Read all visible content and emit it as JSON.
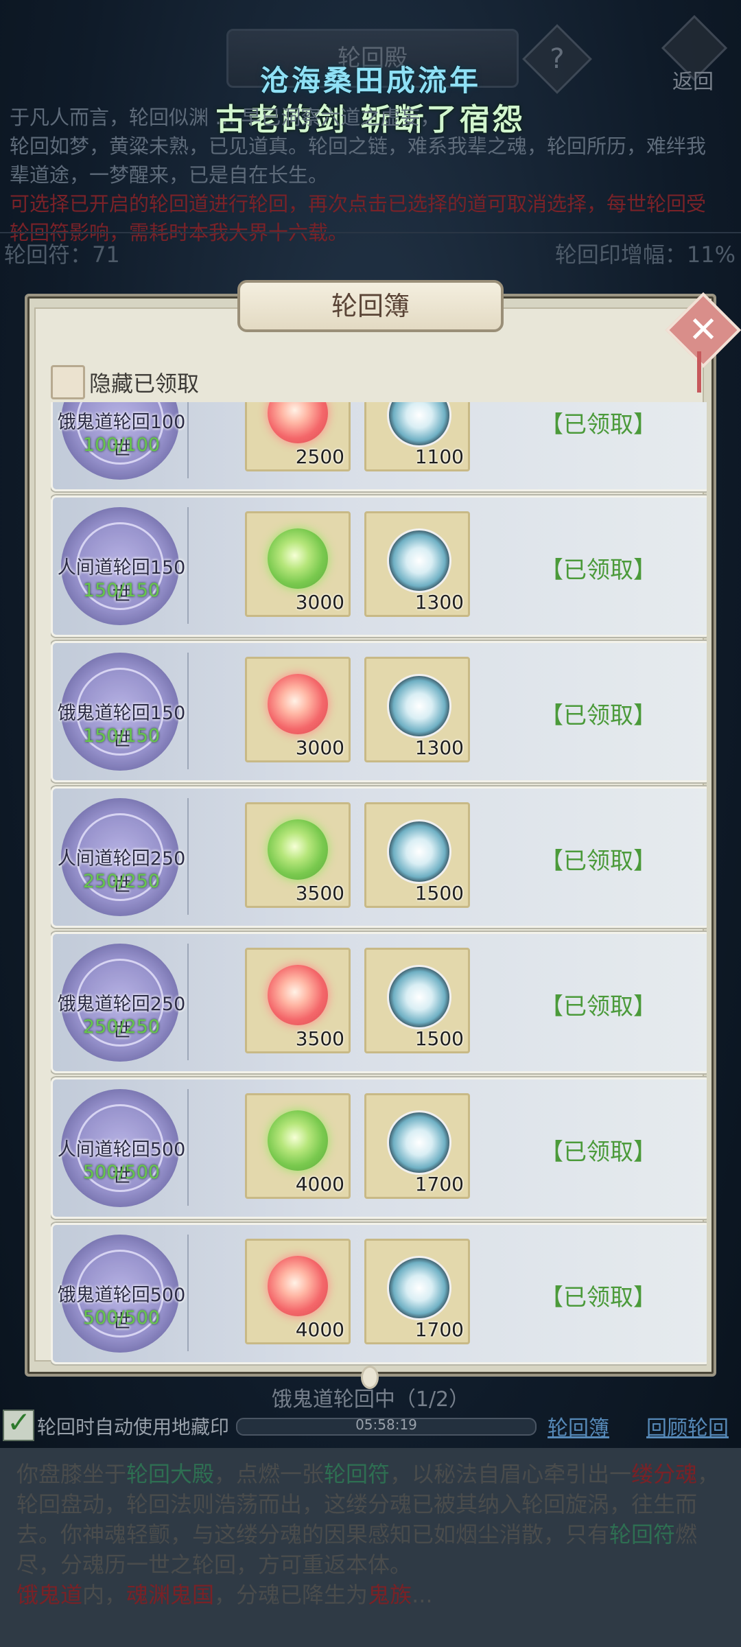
{
  "header": {
    "title": "轮回殿",
    "help_label": "?",
    "back_label": "返回",
    "banner_line1": "沧海桑田成流年",
    "banner_line2": "古老的剑 斩断了宿怨"
  },
  "intro": {
    "line1": "于凡人而言，轮回似渊 … 早已洞察六道之虚妄，",
    "line2": "轮回如梦，黄粱未熟，已见道真。轮回之链，难系我辈之魂，轮回所历，难绊我",
    "line3": "辈道途，一梦醒来，已是自在长生。",
    "warn1": "可选择已开启的轮回道进行轮回，再次点击已选择的道可取消选择，每世轮回受",
    "warn2": "轮回符影响，需耗时本我大界十六载。"
  },
  "stats": {
    "left": "轮回符：71",
    "right": "轮回印增幅：11%"
  },
  "modal": {
    "title": "轮回簿",
    "close_label": "✕",
    "hide_claimed_label": "隐藏已领取",
    "rows": [
      {
        "name": "饿鬼道轮回100世",
        "progress": "100/100",
        "item1_qty": "2500",
        "item2_qty": "1100",
        "status": "【已领取】"
      },
      {
        "name": "人间道轮回150世",
        "progress": "150/150",
        "item1_qty": "3000",
        "item2_qty": "1300",
        "status": "【已领取】"
      },
      {
        "name": "饿鬼道轮回150世",
        "progress": "150/150",
        "item1_qty": "3000",
        "item2_qty": "1300",
        "status": "【已领取】"
      },
      {
        "name": "人间道轮回250世",
        "progress": "250/250",
        "item1_qty": "3500",
        "item2_qty": "1500",
        "status": "【已领取】"
      },
      {
        "name": "饿鬼道轮回250世",
        "progress": "250/250",
        "item1_qty": "3500",
        "item2_qty": "1500",
        "status": "【已领取】"
      },
      {
        "name": "人间道轮回500世",
        "progress": "500/500",
        "item1_qty": "4000",
        "item2_qty": "1700",
        "status": "【已领取】"
      },
      {
        "name": "饿鬼道轮回500世",
        "progress": "500/500",
        "item1_qty": "4000",
        "item2_qty": "1700",
        "status": "【已领取】"
      }
    ]
  },
  "bottom": {
    "status": "饿鬼道轮回中（1/2）",
    "auto_label": "轮回时自动使用地藏印",
    "timer": "05:58:19",
    "link_book": "轮回簿",
    "link_review": "回顾轮回"
  },
  "log": {
    "p1_a": "你盘膝坐于",
    "p1_b": "轮回大殿",
    "p1_c": "，点燃一张",
    "p1_d": "轮回符",
    "p1_e": "，以秘法自眉心牵引出一",
    "p1_f": "缕分魂",
    "p1_g": "，轮回盘动，轮回法则浩荡而出，这缕分魂已被其纳入轮回旋涡，往生而去。你神魂轻颤，与这缕分魂的因果感知已如烟尘消散，只有",
    "p1_h": "轮回符",
    "p1_i": "燃尽，分魂历一世之轮回，方可重返本体。",
    "p2_a": "饿鬼道",
    "p2_b": "内，",
    "p2_c": "魂渊鬼国",
    "p2_d": "，分魂已降生为",
    "p2_e": "鬼族",
    "p2_f": "..."
  },
  "colors": {
    "claimed": "#4b9a3a",
    "progress": "#66c64c",
    "link": "#5689b8"
  }
}
